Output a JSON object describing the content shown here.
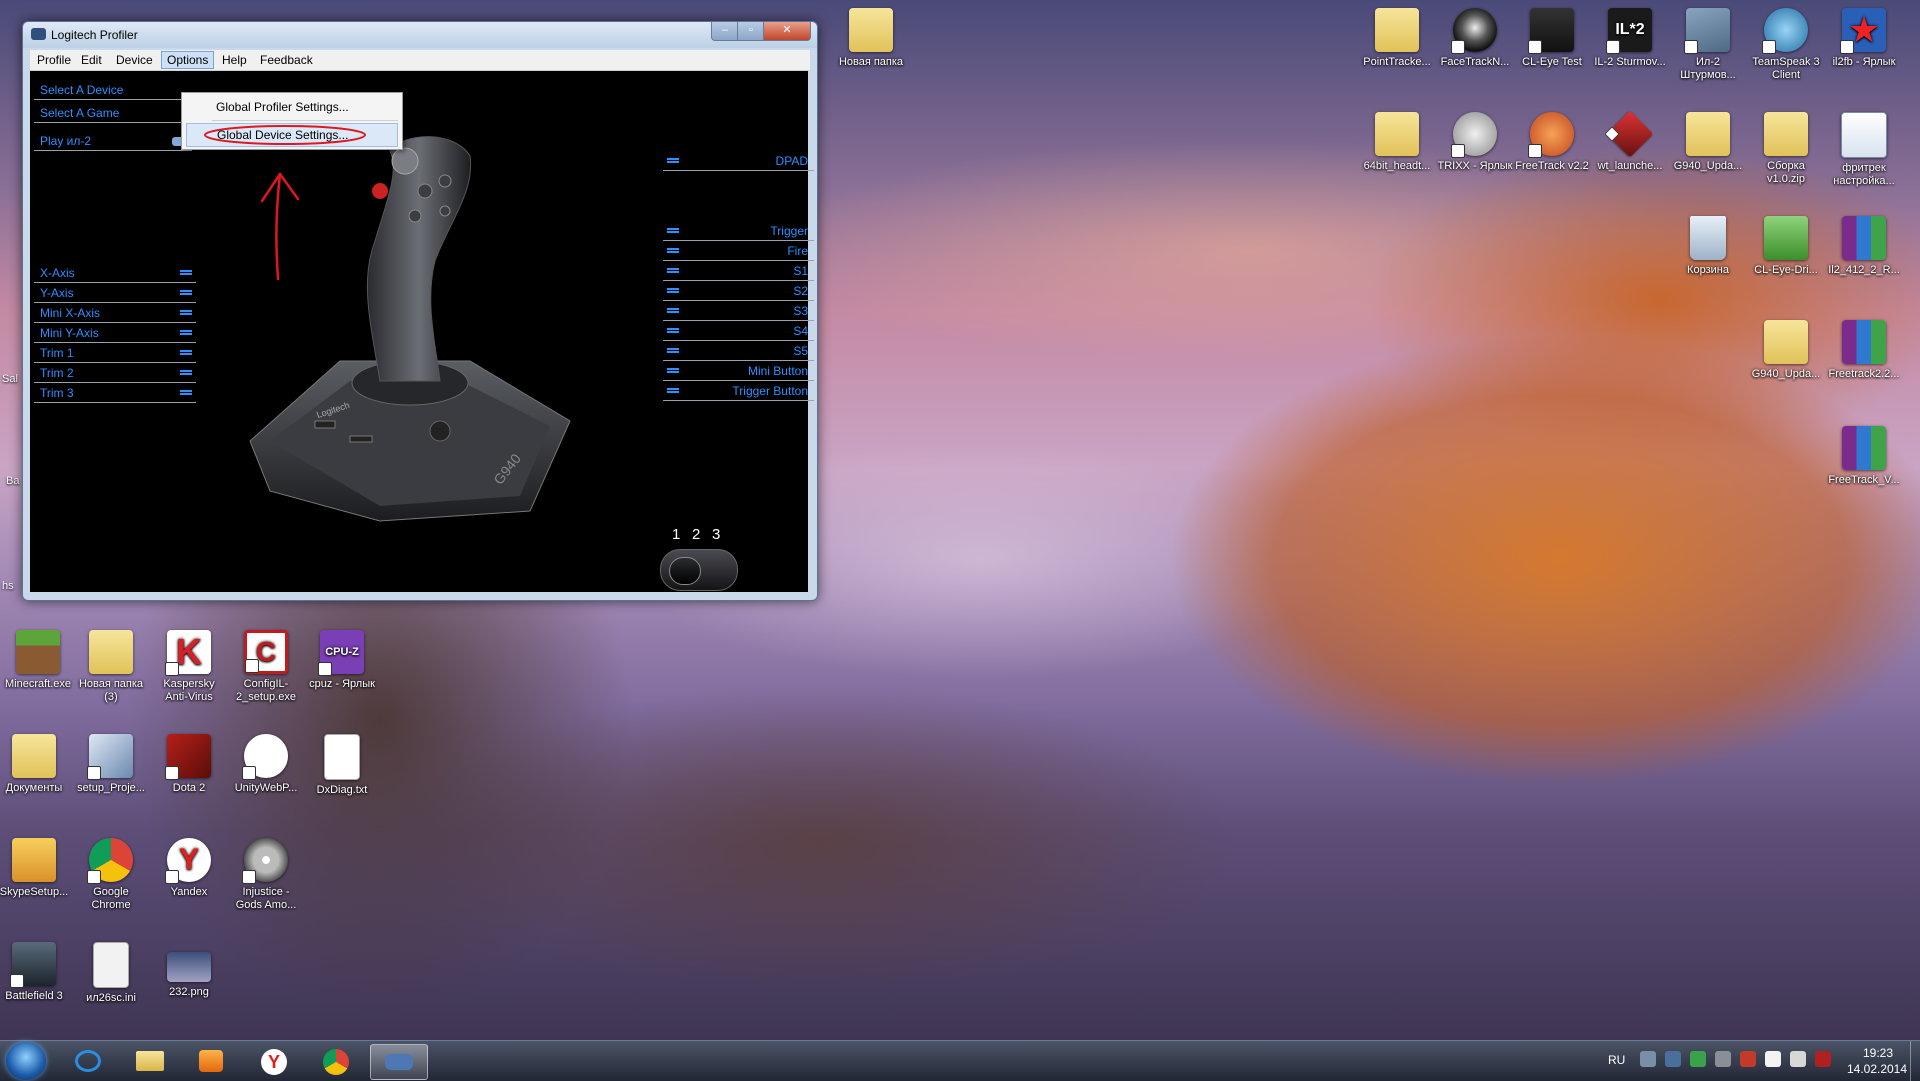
{
  "window": {
    "title": "Logitech Profiler",
    "menu": [
      "Profile",
      "Edit",
      "Device",
      "Options",
      "Help",
      "Feedback"
    ],
    "controls": {
      "minimize": "–",
      "maximize": "▫",
      "close": "✕"
    }
  },
  "options_menu": {
    "items": [
      "Global Profiler Settings...",
      "Global Device Settings..."
    ]
  },
  "sidebar": {
    "select_device": "Select A Device",
    "select_game": "Select A Game",
    "profile": "Play ил-2"
  },
  "axes": [
    "X-Axis",
    "Y-Axis",
    "Mini X-Axis",
    "Mini Y-Axis",
    "Trim 1",
    "Trim 2",
    "Trim 3"
  ],
  "buttons": [
    "DPAD",
    "Trigger",
    "Fire",
    "S1",
    "S2",
    "S3",
    "S4",
    "S5",
    "Mini Button",
    "Trigger Button"
  ],
  "device": {
    "mode_labels": [
      "1",
      "2",
      "3"
    ],
    "brand": "Logitech",
    "model": "G940"
  },
  "desktop_icons_right": [
    {
      "label": "PointTracke...",
      "kind": "folder"
    },
    {
      "label": "FaceTrackN...",
      "kind": "app"
    },
    {
      "label": "CL-Eye Test",
      "kind": "app"
    },
    {
      "label": "IL-2 Sturmov...",
      "kind": "app"
    },
    {
      "label": "Ил-2 Штурмов...",
      "kind": "app"
    },
    {
      "label": "TeamSpeak 3 Client",
      "kind": "app"
    },
    {
      "label": "il2fb - Ярлык",
      "kind": "app"
    },
    {
      "label": "64bit_headt...",
      "kind": "folder"
    },
    {
      "label": "TRIXX - Ярлык",
      "kind": "app"
    },
    {
      "label": "FreeTrack v2.2",
      "kind": "app"
    },
    {
      "label": "wt_launche...",
      "kind": "app"
    },
    {
      "label": "G940_Upda...",
      "kind": "folder"
    },
    {
      "label": "Сборка v1.0.zip",
      "kind": "folder"
    },
    {
      "label": "фритрек настройка...",
      "kind": "file"
    },
    {
      "label": "Корзина",
      "kind": "app"
    },
    {
      "label": "CL-Eye-Dri...",
      "kind": "app"
    },
    {
      "label": "Il2_412_2_R...",
      "kind": "archive"
    },
    {
      "label": "G940_Upda...",
      "kind": "folder"
    },
    {
      "label": "Freetrack2.2...",
      "kind": "archive"
    },
    {
      "label": "FreeTrack_V...",
      "kind": "archive"
    }
  ],
  "desktop_icon_top": {
    "label": "Новая папка"
  },
  "desktop_icons_left": [
    {
      "label": "Minecraft.exe"
    },
    {
      "label": "Новая папка (3)"
    },
    {
      "label": "Kaspersky Anti-Virus"
    },
    {
      "label": "ConfigIL-2_setup.exe"
    },
    {
      "label": "cpuz - Ярлык"
    },
    {
      "label": "Документы"
    },
    {
      "label": "setup_Proje..."
    },
    {
      "label": "Dota 2"
    },
    {
      "label": "UnityWebP..."
    },
    {
      "label": "DxDiag.txt"
    },
    {
      "label": "SkypeSetup..."
    },
    {
      "label": "Google Chrome"
    },
    {
      "label": "Yandex"
    },
    {
      "label": "Injustice - Gods Amo..."
    },
    {
      "label": "Battlefield 3"
    },
    {
      "label": "ил26sc.ini"
    },
    {
      "label": "232.png"
    }
  ],
  "edge_fragments": [
    "Sal",
    "Ba",
    "hs"
  ],
  "taskbar": {
    "language": "RU",
    "time": "19:23",
    "date": "14.02.2014",
    "items": [
      "start",
      "ie",
      "explorer",
      "media-player",
      "yandex",
      "chrome",
      "logitech-profiler"
    ]
  },
  "colors": {
    "accent": "#2e8fff",
    "annotation": "#e0171f"
  }
}
